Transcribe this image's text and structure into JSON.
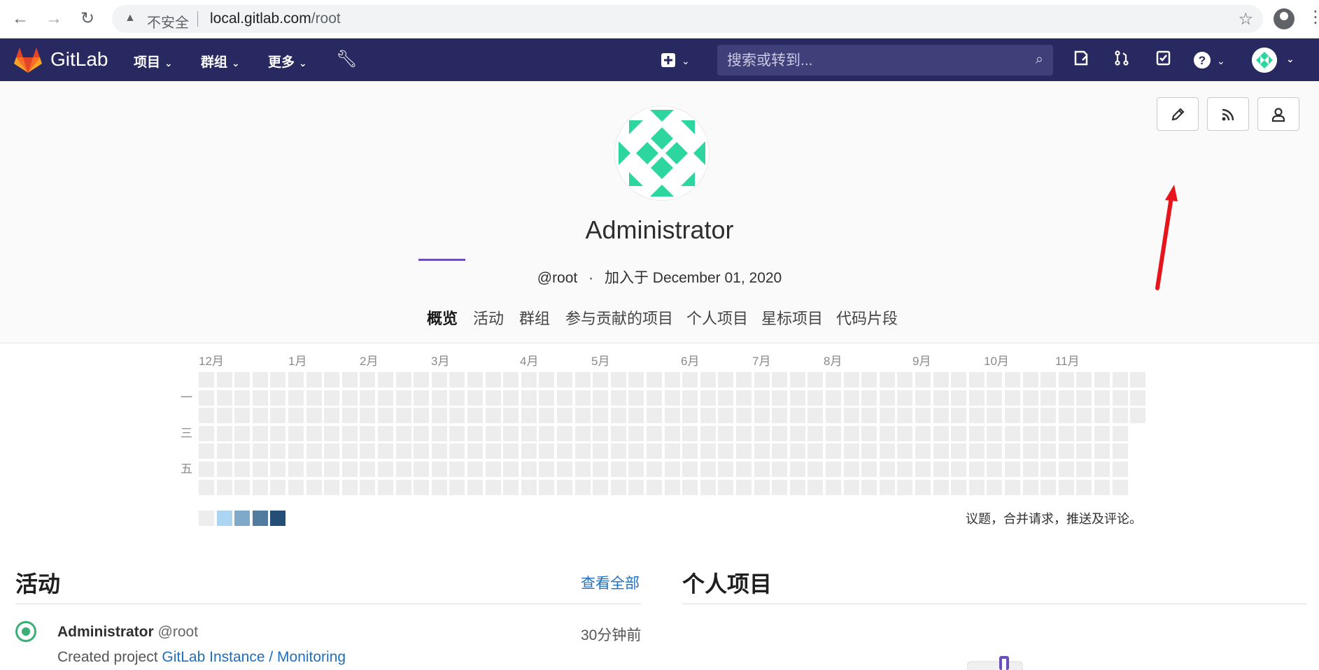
{
  "browser": {
    "insecure_label": "不安全",
    "url_host": "local.gitlab.com",
    "url_path": "/root"
  },
  "navbar": {
    "brand": "GitLab",
    "menus": [
      "项目",
      "群组",
      "更多"
    ],
    "search_placeholder": "搜索或转到...",
    "accent": "#292961"
  },
  "profile": {
    "name": "Administrator",
    "handle": "@root",
    "separator": "·",
    "joined": "加入于 December 01, 2020",
    "tabs": [
      "概览",
      "活动",
      "群组",
      "参与贡献的项目",
      "个人项目",
      "星标项目",
      "代码片段"
    ],
    "active_tab": "概览",
    "actions": [
      "pencil-icon",
      "rss-icon",
      "user-icon"
    ]
  },
  "calendar": {
    "months": [
      "12月",
      "1月",
      "2月",
      "3月",
      "4月",
      "5月",
      "6月",
      "7月",
      "8月",
      "9月",
      "10月",
      "11月"
    ],
    "weekday_labels": [
      "一",
      "三",
      "五"
    ],
    "legend_colors": [
      "#ededed",
      "#acd5f2",
      "#7fa8c9",
      "#527ba0",
      "#254e77"
    ],
    "note": "议题，合并请求，推送及评论。"
  },
  "activity": {
    "title": "活动",
    "view_all": "查看全部",
    "event": {
      "author": "Administrator",
      "handle": "@root",
      "time": "30分钟前",
      "action": "Created project",
      "project": "GitLab Instance / Monitoring"
    }
  },
  "projects": {
    "title": "个人项目"
  }
}
